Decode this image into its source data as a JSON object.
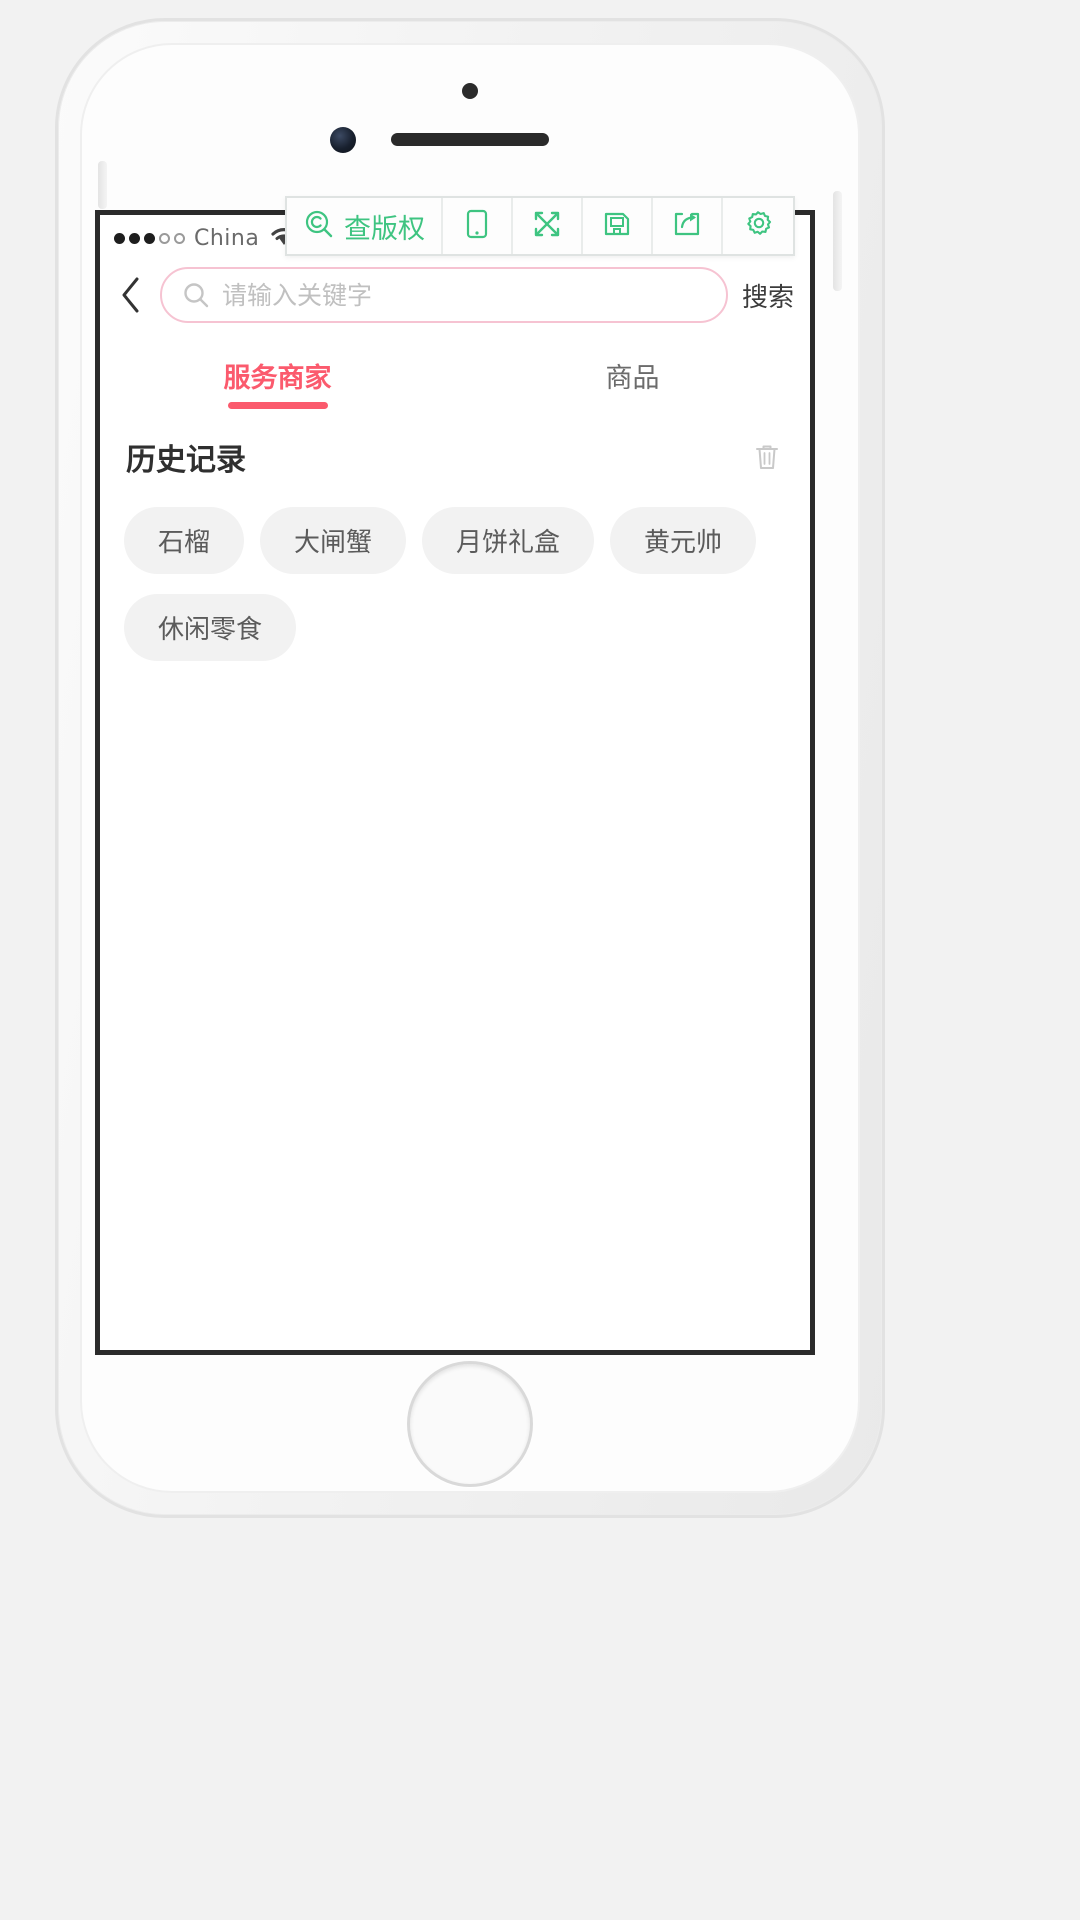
{
  "device": {
    "name": "iphone-mockup"
  },
  "toolbar": {
    "items": [
      {
        "icon": "copyright-search-icon",
        "label": "查版权"
      },
      {
        "icon": "mobile-preview-icon",
        "label": ""
      },
      {
        "icon": "fullscreen-expand-icon",
        "label": ""
      },
      {
        "icon": "save-floppy-icon",
        "label": ""
      },
      {
        "icon": "share-export-icon",
        "label": ""
      },
      {
        "icon": "gear-settings-icon",
        "label": ""
      }
    ]
  },
  "statusbar": {
    "signal_dots_filled": 3,
    "signal_dots_hollow": 2,
    "carrier": "China",
    "wifi_icon": "wifi-icon"
  },
  "search": {
    "back_icon": "back-chevron-icon",
    "magnifier_icon": "search-icon",
    "placeholder": "请输入关键字",
    "value": "",
    "button_label": "搜索"
  },
  "tabs": [
    {
      "label": "服务商家",
      "active": true
    },
    {
      "label": "商品",
      "active": false
    }
  ],
  "history": {
    "title": "历史记录",
    "clear_icon": "trash-icon",
    "tags": [
      "石榴",
      "大闸蟹",
      "月饼礼盒",
      "黄元帅",
      "休闲零食"
    ]
  },
  "colors": {
    "accent_pink": "#fb5a6d",
    "toolbar_green": "#3ec481",
    "tag_bg": "#f2f2f2",
    "page_bg": "#f2f2f2"
  }
}
